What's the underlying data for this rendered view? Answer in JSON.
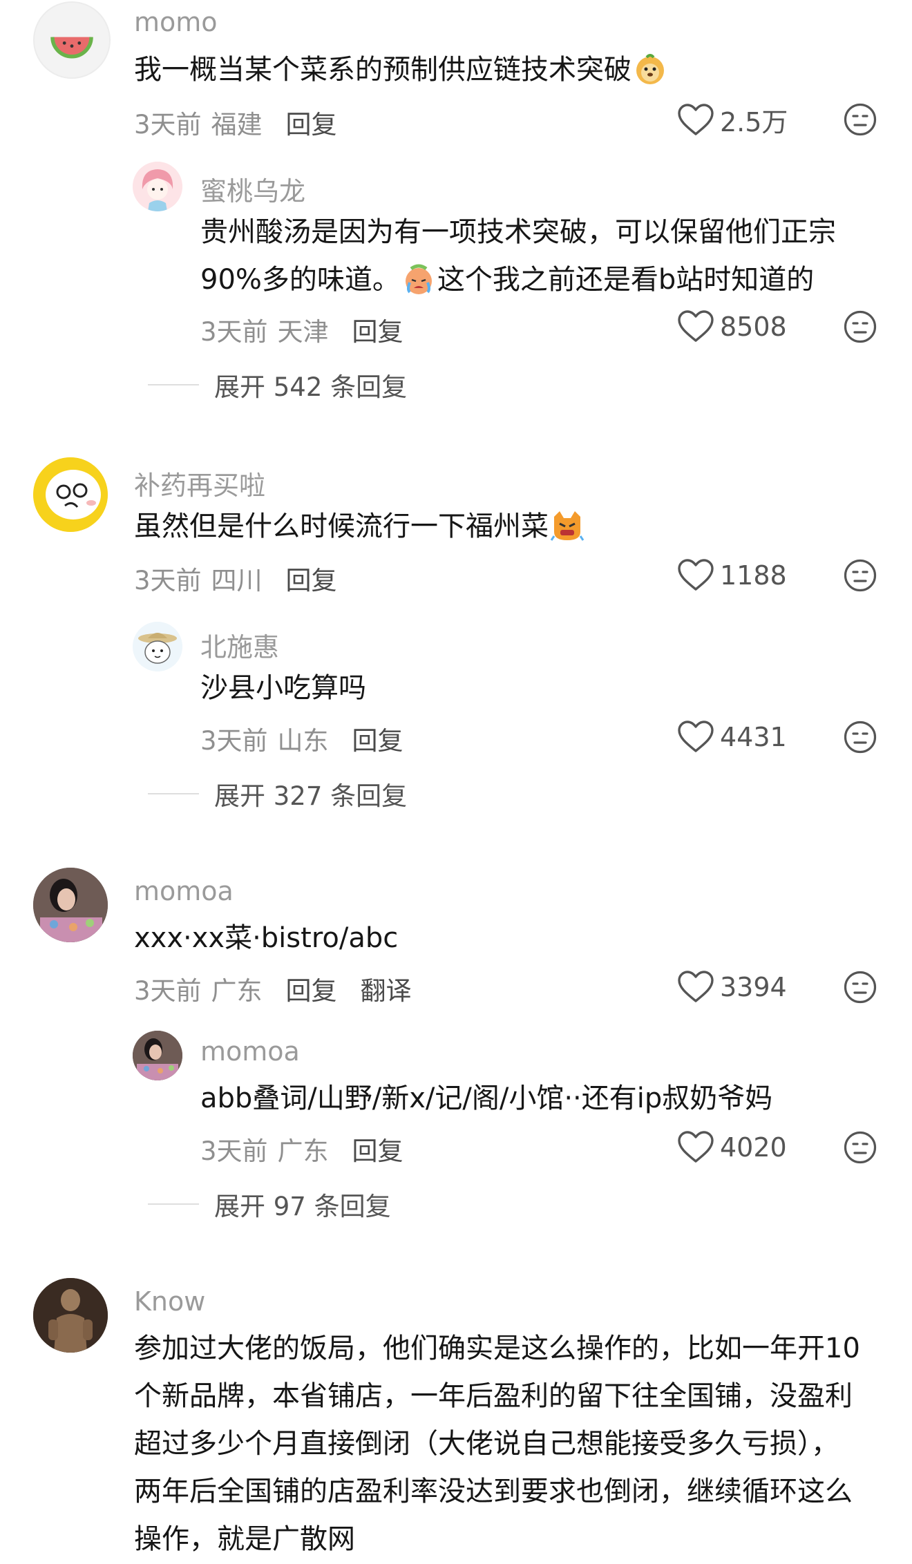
{
  "comments": [
    {
      "username": "momo",
      "text": "我一概当某个菜系的预制供应链技术突破",
      "time": "3天前",
      "location": "福建",
      "reply_label": "回复",
      "likes": "2.5万",
      "replies": [
        {
          "username": "蜜桃乌龙",
          "text_part1": "贵州酸汤是因为有一项技术突破，可以保留他们正宗90%多的味道。",
          "text_part2": "这个我之前还是看b站时知道的",
          "time": "3天前",
          "location": "天津",
          "reply_label": "回复",
          "likes": "8508"
        }
      ],
      "expand_label": "展开 542 条回复"
    },
    {
      "username": "补药再买啦",
      "text": "虽然但是什么时候流行一下福州菜",
      "time": "3天前",
      "location": "四川",
      "reply_label": "回复",
      "likes": "1188",
      "replies": [
        {
          "username": "北施惠",
          "text": "沙县小吃算吗",
          "time": "3天前",
          "location": "山东",
          "reply_label": "回复",
          "likes": "4431"
        }
      ],
      "expand_label": "展开 327 条回复"
    },
    {
      "username": "momoa",
      "text": "xxx·xx菜·bistro/abc",
      "time": "3天前",
      "location": "广东",
      "reply_label": "回复",
      "translate_label": "翻译",
      "likes": "3394",
      "replies": [
        {
          "username": "momoa",
          "text": "abb叠词/山野/新x/记/阁/小馆··还有ip叔奶爷妈",
          "time": "3天前",
          "location": "广东",
          "reply_label": "回复",
          "likes": "4020"
        }
      ],
      "expand_label": "展开 97 条回复"
    },
    {
      "username": "Know",
      "text": "参加过大佬的饭局，他们确实是这么操作的，比如一年开10个新品牌，本省铺店，一年后盈利的留下往全国铺，没盈利超过多少个月直接倒闭（大佬说自己想能接受多久亏损），两年后全国铺的店盈利率没达到要求也倒闭，继续循环这么操作，就是广散网"
    }
  ],
  "icons": {
    "like": "heart-outline-icon",
    "dislike": "frown-face-icon",
    "emoji_1": "lion-face-emoji",
    "emoji_2": "crying-face-emoji",
    "emoji_3": "angry-cat-emoji"
  }
}
